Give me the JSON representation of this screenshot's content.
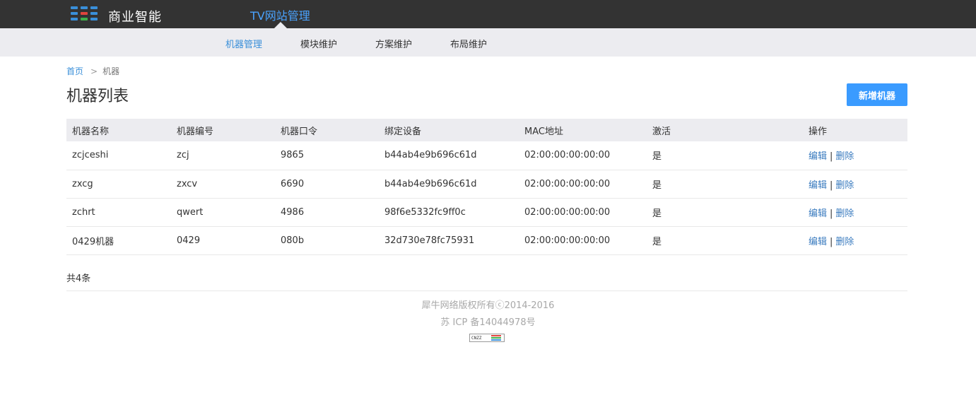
{
  "brand": {
    "name": "商业智能"
  },
  "site": {
    "title": "TV网站管理"
  },
  "subnav": [
    {
      "label": "机器管理",
      "active": true
    },
    {
      "label": "模块维护",
      "active": false
    },
    {
      "label": "方案维护",
      "active": false
    },
    {
      "label": "布局维护",
      "active": false
    }
  ],
  "breadcrumb": {
    "home": "首页",
    "separator": ">",
    "current": "机器"
  },
  "page": {
    "title": "机器列表",
    "add_button": "新增机器"
  },
  "table": {
    "headers": [
      "机器名称",
      "机器编号",
      "机器口令",
      "绑定设备",
      "MAC地址",
      "激活",
      "操作"
    ],
    "rows": [
      {
        "name": "zcjceshi",
        "code": "zcj",
        "password": "9865",
        "device": "b44ab4e9b696c61d",
        "mac": "02:00:00:00:00:00",
        "active": "是"
      },
      {
        "name": "zxcg",
        "code": "zxcv",
        "password": "6690",
        "device": "b44ab4e9b696c61d",
        "mac": "02:00:00:00:00:00",
        "active": "是"
      },
      {
        "name": "zchrt",
        "code": "qwert",
        "password": "4986",
        "device": "98f6e5332fc9ff0c",
        "mac": "02:00:00:00:00:00",
        "active": "是"
      },
      {
        "name": "0429机器",
        "code": "0429",
        "password": "080b",
        "device": "32d730e78fc75931",
        "mac": "02:00:00:00:00:00",
        "active": "是"
      }
    ],
    "edit_label": "编辑",
    "op_separator": "|",
    "delete_label": "删除"
  },
  "total": "共4条",
  "footer": {
    "copyright": "犀牛网络版权所有ⓒ2014-2016",
    "icp": "苏 ICP 备14044978号",
    "badge": "CNZZ"
  },
  "colors": {
    "topbar": "#333333",
    "accent": "#3a9bff",
    "link": "#3a7bbf",
    "subnav_bg": "#ececf0"
  }
}
